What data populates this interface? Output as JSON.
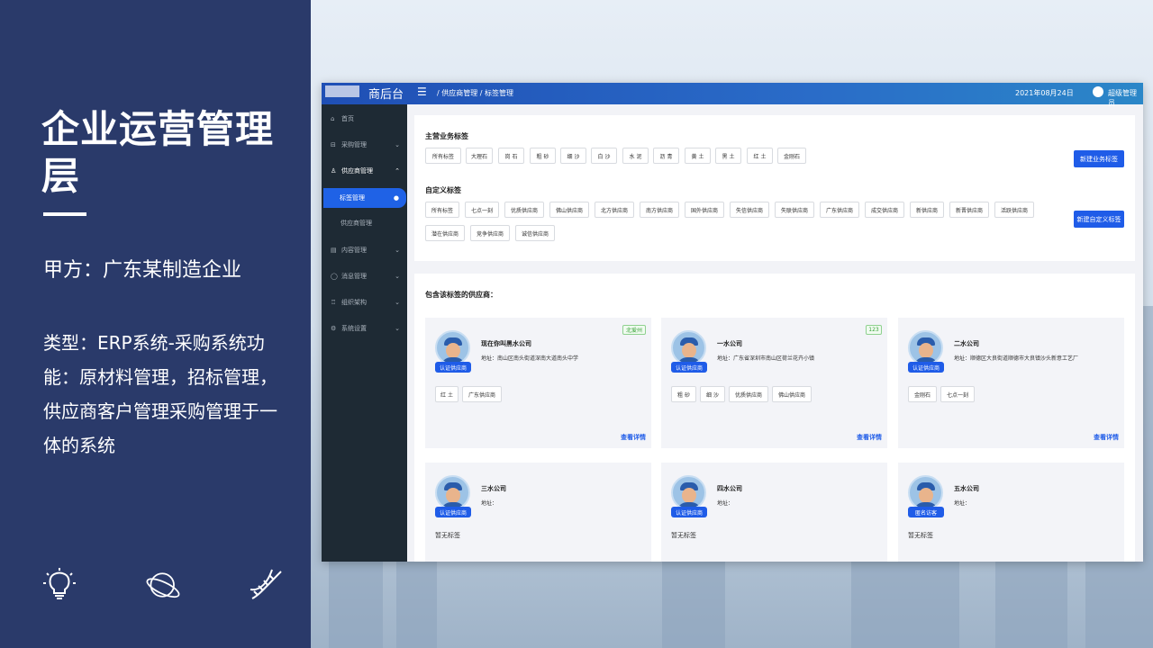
{
  "slide": {
    "title": "企业运营管理层",
    "party": "甲方：广东某制造企业",
    "description": "类型：ERP系统-采购系统功能：原材料管理，招标管理，供应商客户管理采购管理于一体的系统",
    "icons": [
      "lightbulb-icon",
      "planet-icon",
      "dna-icon"
    ]
  },
  "app": {
    "logo_text": "商后台",
    "breadcrumb": "/ 供应商管理 / 标签管理",
    "date": "2021年08月24日",
    "user": "超级管理员",
    "sidebar": {
      "items": [
        {
          "label": "首页",
          "icon": "⌂",
          "chevron": ""
        },
        {
          "label": "采购管理",
          "icon": "⊟",
          "chevron": "⌄"
        },
        {
          "label": "供应商管理",
          "icon": "♙",
          "chevron": "⌃"
        },
        {
          "label": "标签管理",
          "icon": "",
          "chevron": "●"
        },
        {
          "label": "供应商管理",
          "icon": "",
          "chevron": ""
        },
        {
          "label": "内容管理",
          "icon": "▤",
          "chevron": "⌄"
        },
        {
          "label": "消息管理",
          "icon": "◯",
          "chevron": "⌄"
        },
        {
          "label": "组织架构",
          "icon": "♖",
          "chevron": "⌄"
        },
        {
          "label": "系统设置",
          "icon": "⚙",
          "chevron": "⌄"
        }
      ]
    },
    "main_tags": {
      "title": "主营业务标签",
      "tags": [
        "所有标签",
        "大理石",
        "岗 石",
        "粗 砂",
        "细 沙",
        "白 沙",
        "水 泥",
        "沥 青",
        "黄 土",
        "黑 土",
        "红 土",
        "金刚石"
      ],
      "button": "新建业务标签"
    },
    "custom_tags": {
      "title": "自定义标签",
      "tags_row1": [
        "所有标签",
        "七点一刻",
        "优质供应商",
        "佛山供应商",
        "北方供应商",
        "南方供应商",
        "国外供应商",
        "失信供应商",
        "失联供应商",
        "广东供应商",
        "成交供应商",
        "新供应商",
        "新晋供应商",
        "活跃供应商"
      ],
      "tags_row2": [
        "潜在供应商",
        "竞争供应商",
        "诚信供应商"
      ],
      "button": "新建自定义标签"
    },
    "suppliers_title": "包含该标签的供应商：",
    "suppliers": [
      {
        "name": "现在你叫黑水公司",
        "address": "地址：南山区南头街道深南大道南头中学",
        "badge": "北爱州",
        "cert": "认证供应商",
        "tags": [
          "红 土",
          "广东供应商"
        ],
        "detail": "查看详情"
      },
      {
        "name": "一水公司",
        "address": "地址：广东省深圳市南山区荷兰花卉小镇",
        "badge": "123",
        "cert": "认证供应商",
        "tags": [
          "粗 砂",
          "细 沙",
          "优质供应商",
          "佛山供应商"
        ],
        "detail": "查看详情"
      },
      {
        "name": "二水公司",
        "address": "地址：顺德区大良街道顺德市大良镇沙头新意工艺厂",
        "badge": "",
        "cert": "认证供应商",
        "tags": [
          "金刚石",
          "七点一刻"
        ],
        "detail": "查看详情"
      },
      {
        "name": "三水公司",
        "address": "地址：",
        "badge": "",
        "cert": "认证供应商",
        "tags": [],
        "notag": "暂无标签"
      },
      {
        "name": "四水公司",
        "address": "地址：",
        "badge": "",
        "cert": "认证供应商",
        "tags": [],
        "notag": "暂无标签"
      },
      {
        "name": "五水公司",
        "address": "地址：",
        "badge": "",
        "cert": "匿名访客",
        "tags": [],
        "notag": "暂无标签"
      }
    ]
  }
}
